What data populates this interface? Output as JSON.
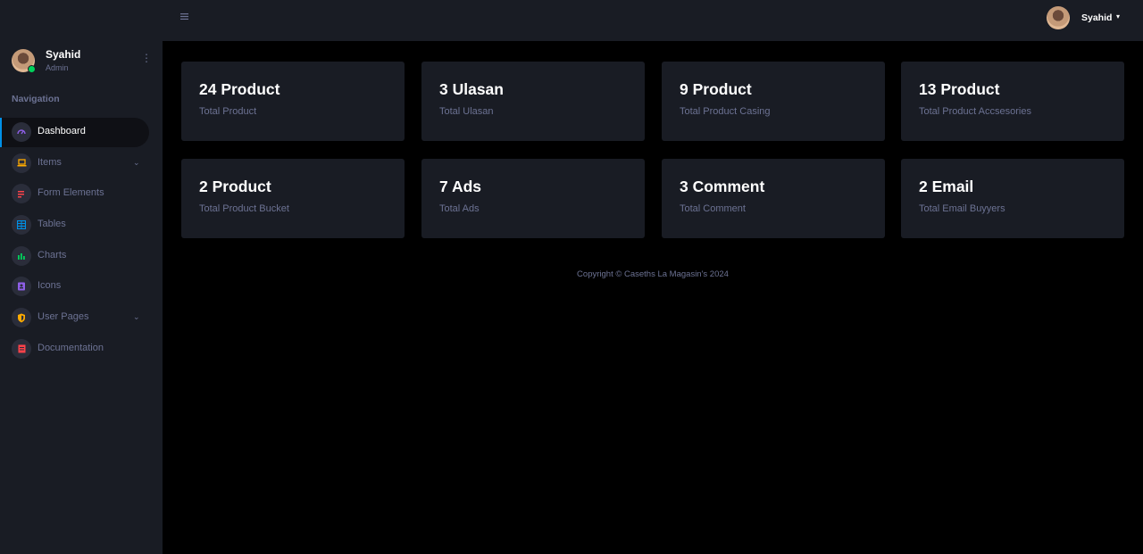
{
  "sidebar": {
    "profile": {
      "name": "Syahid",
      "role": "Admin",
      "menu_icon": "more-vertical-icon"
    },
    "nav_heading": "Navigation",
    "items": [
      {
        "label": "Dashboard",
        "icon": "speedometer-icon",
        "color": "#8f5fe8",
        "active": true
      },
      {
        "label": "Items",
        "icon": "laptop-icon",
        "color": "#ffab00",
        "has_submenu": true
      },
      {
        "label": "Form Elements",
        "icon": "playlist-play-icon",
        "color": "#fc424a"
      },
      {
        "label": "Tables",
        "icon": "table-icon",
        "color": "#0090e7"
      },
      {
        "label": "Charts",
        "icon": "chart-bar-icon",
        "color": "#00d25b"
      },
      {
        "label": "Icons",
        "icon": "contacts-icon",
        "color": "#8f5fe8"
      },
      {
        "label": "User Pages",
        "icon": "security-icon",
        "color": "#ffab00",
        "has_submenu": true
      },
      {
        "label": "Documentation",
        "icon": "file-document-icon",
        "color": "#fc424a"
      }
    ]
  },
  "topbar": {
    "menu_icon": "hamburger-menu-icon",
    "user_name": "Syahid"
  },
  "cards": [
    {
      "value": "24 Product",
      "label": "Total Product"
    },
    {
      "value": "3 Ulasan",
      "label": "Total Ulasan"
    },
    {
      "value": "9 Product",
      "label": "Total Product Casing"
    },
    {
      "value": "13 Product",
      "label": "Total Product Accsesories"
    },
    {
      "value": "2 Product",
      "label": "Total Product Bucket"
    },
    {
      "value": "7 Ads",
      "label": "Total Ads"
    },
    {
      "value": "3 Comment",
      "label": "Total Comment"
    },
    {
      "value": "2 Email",
      "label": "Total Email Buyyers"
    }
  ],
  "footer": {
    "text": "Copyright © Caseths La Magasin's 2024"
  },
  "colors": {
    "sidebar_bg": "#191c24",
    "content_bg": "#000000",
    "card_bg": "#191c24",
    "muted_text": "#6c7293",
    "active_indicator": "#0090e7"
  }
}
